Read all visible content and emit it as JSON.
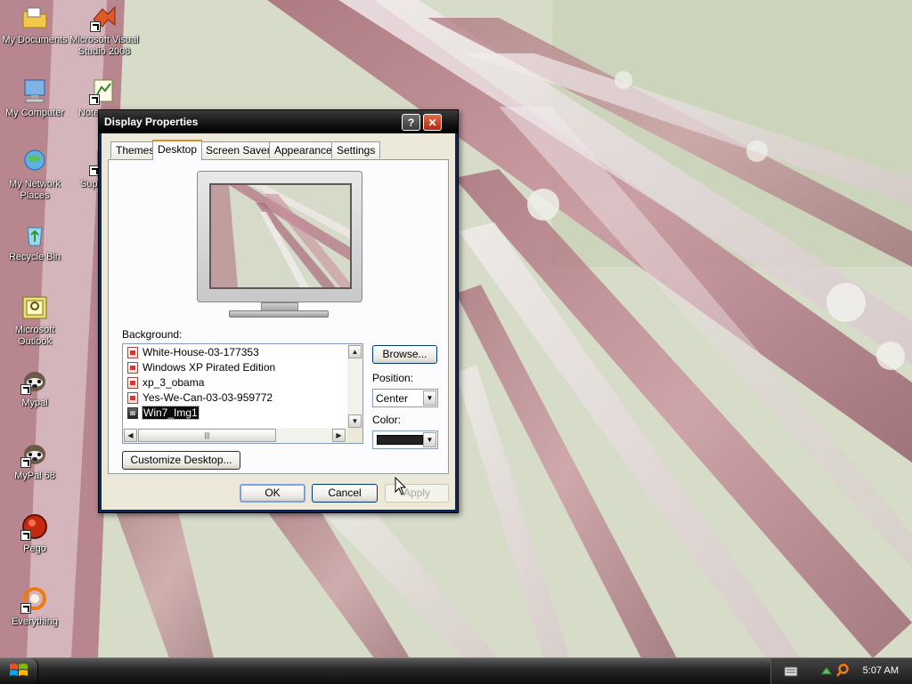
{
  "desktop": {
    "icons": [
      {
        "label": "My Documents",
        "icon": "folder-icon",
        "shortcut": false
      },
      {
        "label": "Microsoft Visual Studio 2008",
        "icon": "visual-studio-icon",
        "shortcut": true
      },
      {
        "label": "My Computer",
        "icon": "computer-icon",
        "shortcut": false
      },
      {
        "label": "Note",
        "icon": "notepad-icon",
        "shortcut": true
      },
      {
        "label": "My Network Places",
        "icon": "network-icon",
        "shortcut": false
      },
      {
        "label": "Supe",
        "icon": "app-icon",
        "shortcut": true
      },
      {
        "label": "Recycle Bin",
        "icon": "recycle-bin-icon",
        "shortcut": false
      },
      {
        "label": "Microsoft Outlook",
        "icon": "outlook-icon",
        "shortcut": false
      },
      {
        "label": "Mypal",
        "icon": "mypal-icon",
        "shortcut": true
      },
      {
        "label": "MyPal 68",
        "icon": "mypal-icon",
        "shortcut": true
      },
      {
        "label": "Pego",
        "icon": "pego-icon",
        "shortcut": true
      },
      {
        "label": "Everything",
        "icon": "search-ring-icon",
        "shortcut": true
      }
    ]
  },
  "dialog": {
    "title": "Display Properties",
    "help_label": "?",
    "close_label": "✕",
    "tabs": [
      {
        "label": "Themes",
        "active": false
      },
      {
        "label": "Desktop",
        "active": true
      },
      {
        "label": "Screen Saver",
        "active": false
      },
      {
        "label": "Appearance",
        "active": false
      },
      {
        "label": "Settings",
        "active": false
      }
    ],
    "background_label": "Background:",
    "backgrounds": [
      {
        "name": "White-House-03-177353",
        "selected": false
      },
      {
        "name": "Windows XP Pirated Edition",
        "selected": false
      },
      {
        "name": "xp_3_obama",
        "selected": false
      },
      {
        "name": "Yes-We-Can-03-03-959772",
        "selected": false
      },
      {
        "name": "Win7_Img1",
        "selected": true
      }
    ],
    "browse_label": "Browse...",
    "position_label": "Position:",
    "position_value": "Center",
    "color_label": "Color:",
    "color_value": "#222222",
    "customize_label": "Customize Desktop...",
    "ok_label": "OK",
    "cancel_label": "Cancel",
    "apply_label": "Apply"
  },
  "taskbar": {
    "clock": "5:07 AM"
  }
}
